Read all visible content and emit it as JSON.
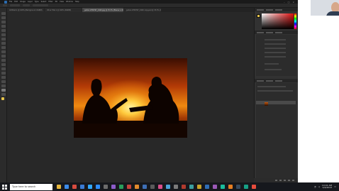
{
  "menu": [
    "File",
    "Edit",
    "Image",
    "Layer",
    "Type",
    "Select",
    "Filter",
    "3D",
    "View",
    "Window",
    "Help"
  ],
  "document_tabs": [
    {
      "label": "Untitled-1 @ 100% (Background, RGB/8)"
    },
    {
      "label": "Ohne Titel-1 @ 100% (RGB/8)"
    },
    {
      "label": "guitar-1789767_1920.jpg @ 33.3% (Ebene 1, RGB/8)"
    },
    {
      "label": "guitar-1789767_1920 copy.psd @ 33.3% (RGB/8)"
    }
  ],
  "taskbar": {
    "search_placeholder": "Type here to search",
    "time": "10:41 AM",
    "date": "4/4/2023"
  },
  "colors": {
    "accent": "#2b6cb0",
    "foreground_swatch": "#e6c44a",
    "canvas_bg": "#282828"
  },
  "icons": [
    "photoshop-logo-icon",
    "windows-start-icon",
    "file-explorer-icon",
    "chrome-icon",
    "photoshop-taskbar-icon",
    "zoom-icon"
  ]
}
